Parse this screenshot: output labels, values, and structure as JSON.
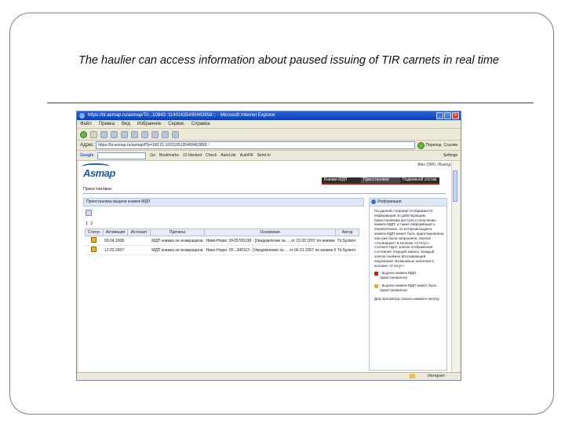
{
  "caption": "The haulier can access information about paused issuing of TIR carnets in real time",
  "browser": {
    "title": "https://tir.asmap.ru/asmap/Tir...10843::11401635490463958::: - Microsoft Internet Explorer",
    "menu": [
      "Файл",
      "Правка",
      "Вид",
      "Избранное",
      "Сервис",
      "Справка"
    ],
    "address_label": "Адрес",
    "address_value": "https://tir.asmap.ru/asmap/f?p=100:31:1001105135490463958:::",
    "go_label": "Переход",
    "links_label": "Ссылки",
    "google_label": "Google",
    "google_items": [
      "Go",
      "Bookmarks",
      "12 blocked",
      "Check",
      "AutoLink",
      "AutoFill",
      "Send to"
    ],
    "google_settings": "Settings",
    "status_zone": "Интернет"
  },
  "site": {
    "logo": "Asmap",
    "top_right": "Alex (000) | Выход",
    "tabs": [
      "Книжки МДП",
      "Приостановки",
      "Подвижной состав"
    ],
    "breadcrumb": "Приостановки",
    "panel_title": "Приостановка выдачи книжек МДП",
    "pages": [
      "1",
      "2"
    ],
    "table": {
      "headers": [
        "Статус",
        "Активация",
        "Истекает",
        "Причина",
        "Основание",
        "Автор"
      ],
      "rows": [
        {
          "activation": "09.04.2008",
          "expires": "",
          "reason": "МДП книжка не возвращена",
          "basis": "Ниво-Норм: XF25700138 - [Уведомление № ... от 23.02.2007 по книжке МДП: XF...]",
          "author": "Tir.System"
        },
        {
          "activation": "12.03.2007",
          "expires": "",
          "reason": "МДП книжка не возвращена",
          "basis": "Ниво-Норм: XF...340113 - [Уведомление № ... от 06.01.2007 по книжке МДП: XF...]",
          "author": "Tir.System"
        }
      ]
    },
    "info": {
      "title": "Информация",
      "text": "На данной странице отображается информация по действующим приостановкам доступа к получению книжек МДП, а также информация о перевозчиках, по которым выдача книжек МДП может быть приостановлена или уже была запрошена. Значок «Активация» в колонке «Статус» соответствует значок отображения состояния текущей записи. Каждый значок снабжен всплывающей подсказкой. Возможные значения в колонке «Статус»:",
      "legend": [
        {
          "color": "red",
          "text": "- выдача книжек МДП приостановлена"
        },
        {
          "color": "yellow",
          "text": "- выдача книжек МДП может быть приостановлена"
        }
      ],
      "footer": "Для просмотра списка нажмите кнопку"
    }
  }
}
